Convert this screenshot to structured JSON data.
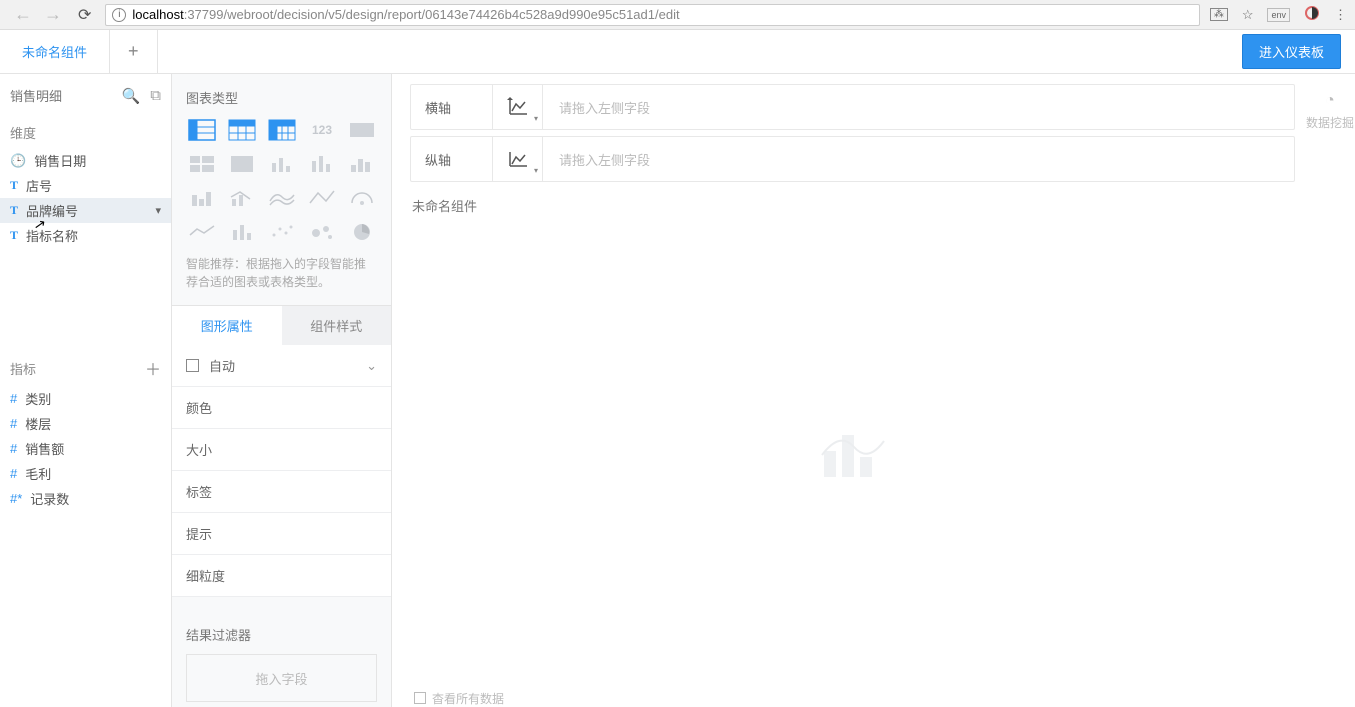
{
  "browser": {
    "url_host": "localhost",
    "url_path": ":37799/webroot/decision/v5/design/report/06143e74426b4c528a9d990e95c51ad1/edit",
    "translate_icon": "⁠",
    "star_icon": "☆",
    "ext1": "env",
    "menu": "⋮"
  },
  "topbar": {
    "tab_label": "未命名组件",
    "add_tab": "+",
    "enter_dashboard": "进入仪表板"
  },
  "left": {
    "dataset": "销售明细",
    "dim_title": "维度",
    "metric_title": "指标",
    "dims": [
      {
        "icon": "clock",
        "label": "销售日期"
      },
      {
        "icon": "T",
        "label": "店号"
      },
      {
        "icon": "T",
        "label": "品牌编号",
        "selected": true
      },
      {
        "icon": "T",
        "label": "指标名称"
      }
    ],
    "metrics": [
      {
        "icon": "#",
        "label": "类别"
      },
      {
        "icon": "#",
        "label": "楼层"
      },
      {
        "icon": "#",
        "label": "销售额"
      },
      {
        "icon": "#",
        "label": "毛利"
      },
      {
        "icon": "#*",
        "label": "记录数"
      }
    ]
  },
  "mid": {
    "chart_type_title": "图表类型",
    "hint": "智能推荐：根据拖入的字段智能推荐合适的图表或表格类型。",
    "subtabs": {
      "gfx": "图形属性",
      "style": "组件样式"
    },
    "auto": "自动",
    "props": [
      "颜色",
      "大小",
      "标签",
      "提示",
      "细粒度"
    ],
    "filter_title": "结果过滤器",
    "filter_placeholder": "拖入字段"
  },
  "canvas": {
    "haxis": "横轴",
    "vaxis": "纵轴",
    "axis_placeholder": "请拖入左侧字段",
    "component_title": "未命名组件",
    "footer": "杳看所有数据"
  },
  "rightbar": {
    "label": "数据挖掘"
  }
}
